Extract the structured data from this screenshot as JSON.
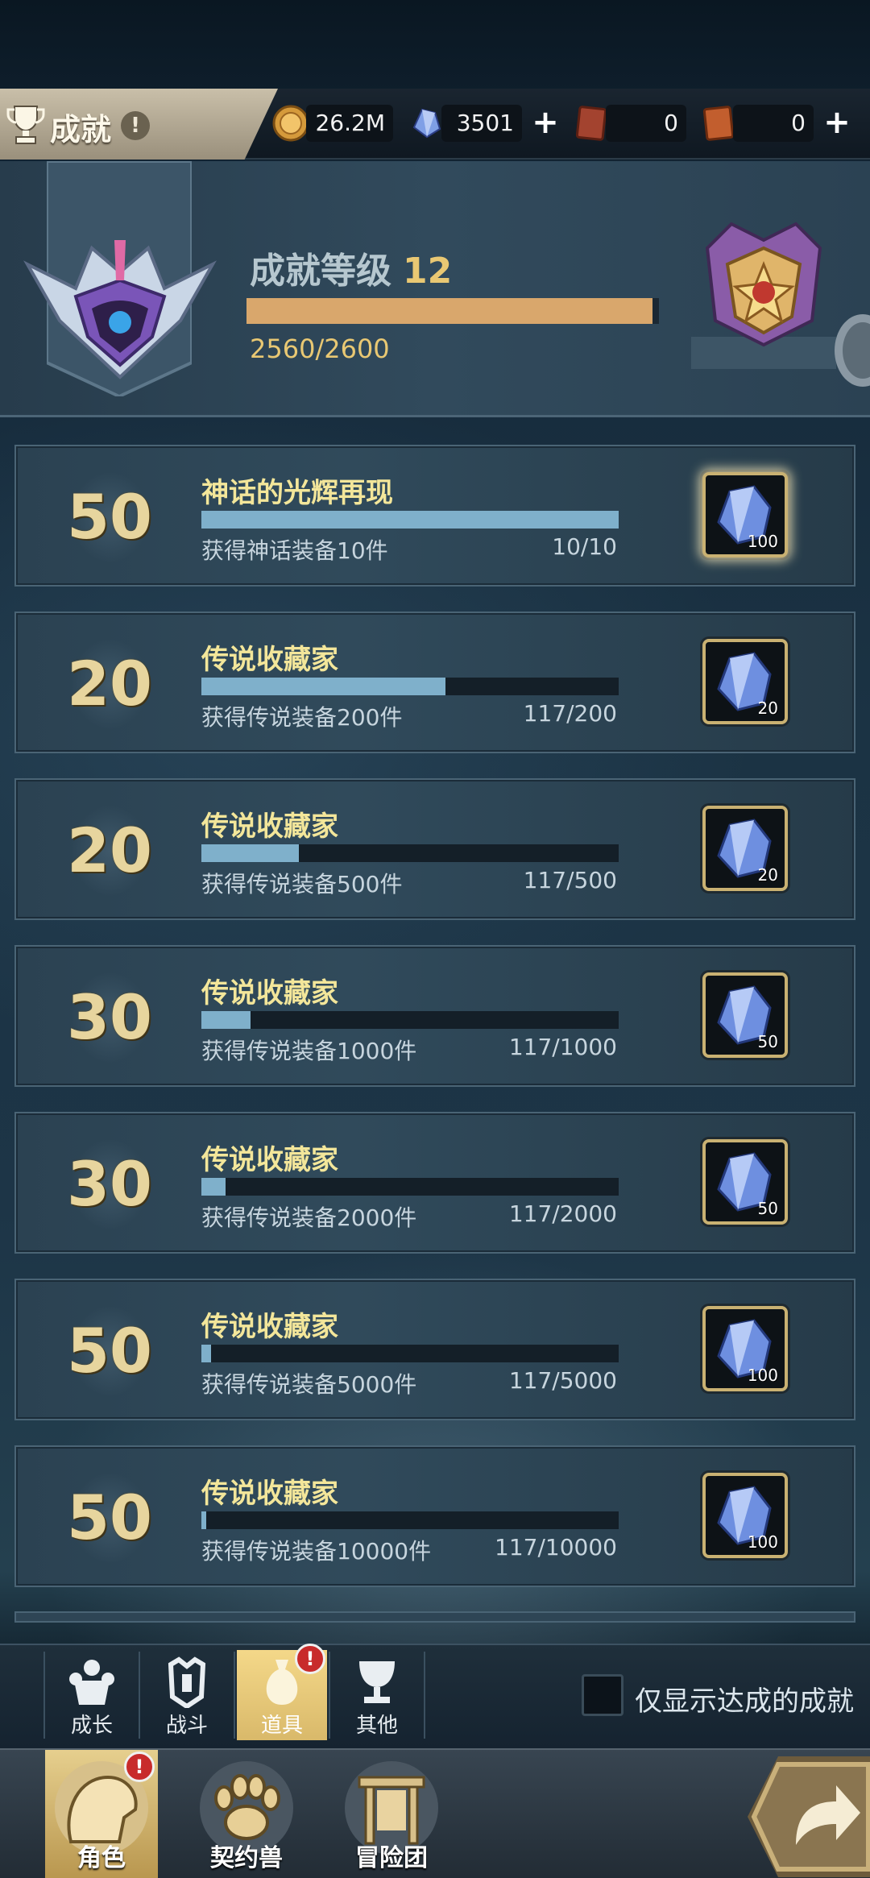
{
  "header": {
    "title": "成就",
    "info_icon": "info-icon",
    "currencies": [
      {
        "name": "gold-coin",
        "value": "26.2M",
        "plus": false
      },
      {
        "name": "blue-crystal",
        "value": "3501",
        "plus": true
      },
      {
        "name": "red-ticket",
        "value": "0",
        "plus": false
      },
      {
        "name": "orange-ticket",
        "value": "0",
        "plus": true
      }
    ],
    "plus_label": "+"
  },
  "level": {
    "title": "成就等级",
    "level": "12",
    "progress_text": "2560/2600",
    "progress_fraction": 0.9846
  },
  "achievements": [
    {
      "points": "50",
      "name": "神话的光辉再现",
      "desc": "获得神话装备10件",
      "count": "10/10",
      "progress": 1.0,
      "reward_qty": "100",
      "glow": true
    },
    {
      "points": "20",
      "name": "传说收藏家",
      "desc": "获得传说装备200件",
      "count": "117/200",
      "progress": 0.585,
      "reward_qty": "20",
      "glow": false
    },
    {
      "points": "20",
      "name": "传说收藏家",
      "desc": "获得传说装备500件",
      "count": "117/500",
      "progress": 0.234,
      "reward_qty": "20",
      "glow": false
    },
    {
      "points": "30",
      "name": "传说收藏家",
      "desc": "获得传说装备1000件",
      "count": "117/1000",
      "progress": 0.117,
      "reward_qty": "50",
      "glow": false
    },
    {
      "points": "30",
      "name": "传说收藏家",
      "desc": "获得传说装备2000件",
      "count": "117/2000",
      "progress": 0.0585,
      "reward_qty": "50",
      "glow": false
    },
    {
      "points": "50",
      "name": "传说收藏家",
      "desc": "获得传说装备5000件",
      "count": "117/5000",
      "progress": 0.0234,
      "reward_qty": "100",
      "glow": false
    },
    {
      "points": "50",
      "name": "传说收藏家",
      "desc": "获得传说装备10000件",
      "count": "117/10000",
      "progress": 0.0117,
      "reward_qty": "100",
      "glow": false
    }
  ],
  "subtabs": [
    {
      "label": "成长",
      "icon": "growth-icon",
      "active": false,
      "badge": false
    },
    {
      "label": "战斗",
      "icon": "battle-icon",
      "active": false,
      "badge": false
    },
    {
      "label": "道具",
      "icon": "item-bag-icon",
      "active": true,
      "badge": true
    },
    {
      "label": "其他",
      "icon": "cup-icon",
      "active": false,
      "badge": false
    }
  ],
  "filter": {
    "label": "仅显示达成的成就",
    "checked": false
  },
  "badge_mark": "!",
  "bottom_nav": [
    {
      "label": "角色",
      "icon": "character-icon",
      "active": true,
      "badge": true
    },
    {
      "label": "契约兽",
      "icon": "paw-icon",
      "active": false,
      "badge": false
    },
    {
      "label": "冒险团",
      "icon": "guild-icon",
      "active": false,
      "badge": false
    }
  ],
  "colors": {
    "progress_fill": "#7fb0cb",
    "level_fill": "#d9a76c",
    "gold_text": "#e9c873",
    "achievement_name": "#f3e69a",
    "badge_red": "#c82b2b"
  }
}
